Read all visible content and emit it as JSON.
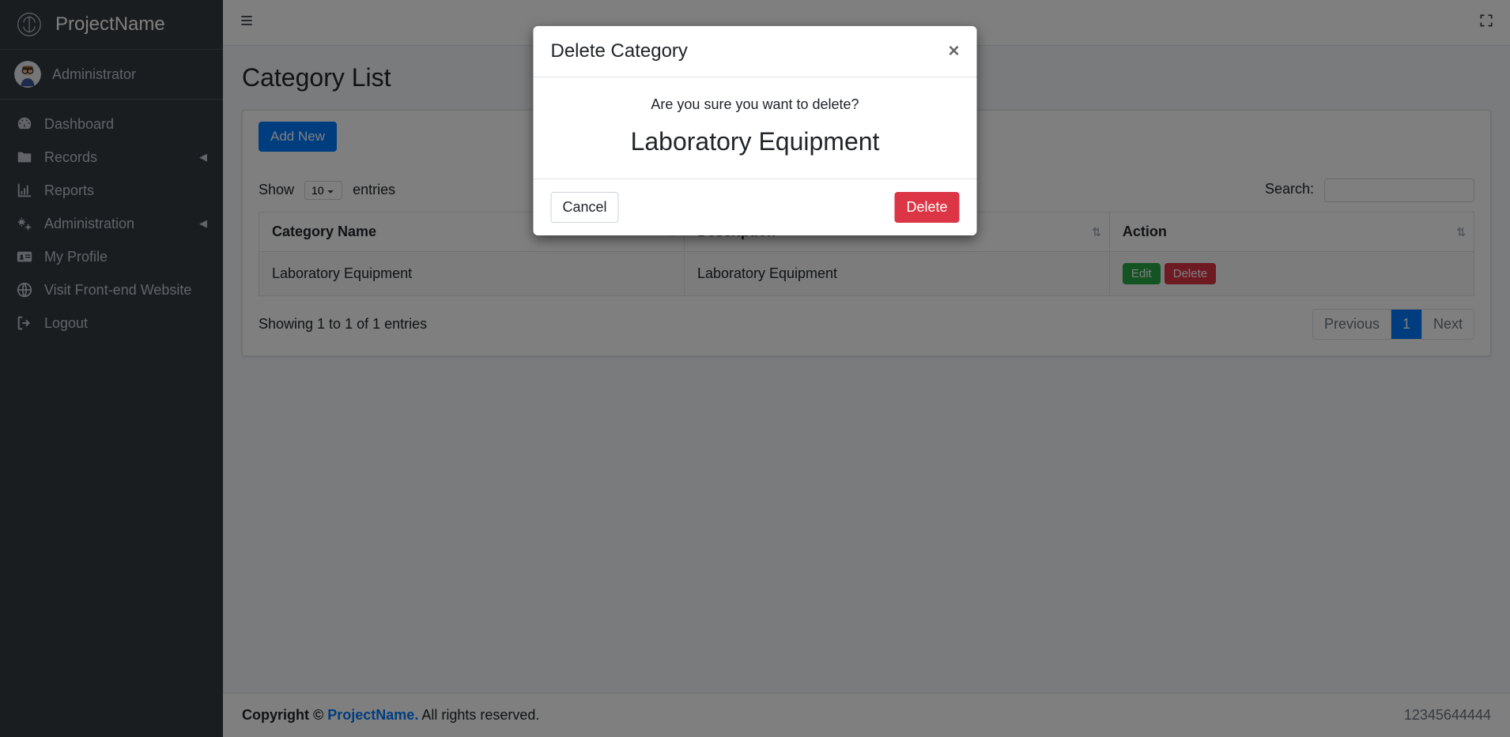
{
  "brand": {
    "name": "ProjectName"
  },
  "user": {
    "name": "Administrator"
  },
  "nav": {
    "dashboard": "Dashboard",
    "records": "Records",
    "reports": "Reports",
    "administration": "Administration",
    "myprofile": "My Profile",
    "frontend": "Visit Front-end Website",
    "logout": "Logout"
  },
  "page": {
    "title": "Category List"
  },
  "card": {
    "add_new": "Add New"
  },
  "datatable": {
    "show_prefix": "Show",
    "show_suffix": "entries",
    "page_size": "10",
    "search_label": "Search:",
    "columns": {
      "name": "Category Name",
      "description": "Description",
      "action": "Action"
    },
    "row": {
      "name": "Laboratory Equipment",
      "description": "Laboratory Equipment",
      "edit": "Edit",
      "delete": "Delete"
    },
    "info": "Showing 1 to 1 of 1 entries",
    "previous": "Previous",
    "next": "Next",
    "current_page": "1"
  },
  "footer": {
    "copyright_prefix": "Copyright © ",
    "link": "ProjectName.",
    "rest": " All rights reserved.",
    "version": "12345644444"
  },
  "modal": {
    "title": "Delete Category",
    "question": "Are you sure you want to delete?",
    "item_name": "Laboratory Equipment",
    "cancel": "Cancel",
    "delete": "Delete"
  },
  "colors": {
    "primary": "#007bff",
    "danger": "#dc3545",
    "success": "#28a745",
    "sidebar": "#343a40"
  }
}
